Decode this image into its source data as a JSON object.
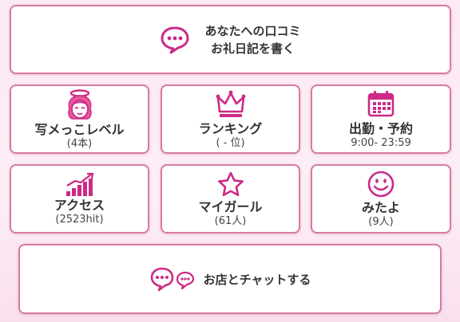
{
  "review_button": {
    "line1": "あなたへの口コミ",
    "line2": "お礼日記を書く",
    "icon": "speech-bubble-dots-icon"
  },
  "tiles": [
    {
      "label": "写メっこレベル",
      "sub": "(4本)",
      "icon": "angel-girl-icon"
    },
    {
      "label": "ランキング",
      "sub": "( - 位)",
      "icon": "crown-icon"
    },
    {
      "label": "出勤・予約",
      "sub": "9:00- 23:59",
      "icon": "calendar-icon"
    },
    {
      "label": "アクセス",
      "sub": "(2523hit)",
      "icon": "bar-chart-icon"
    },
    {
      "label": "マイガール",
      "sub": "(61人)",
      "icon": "star-icon"
    },
    {
      "label": "みたよ",
      "sub": "(9人)",
      "icon": "smiley-icon"
    }
  ],
  "chat_button": {
    "label": "お店とチャットする",
    "icon": "double-speech-bubble-icon"
  },
  "colors": {
    "accent": "#cc2a86",
    "border": "#d77aa0",
    "background": "#fbe9f3"
  }
}
